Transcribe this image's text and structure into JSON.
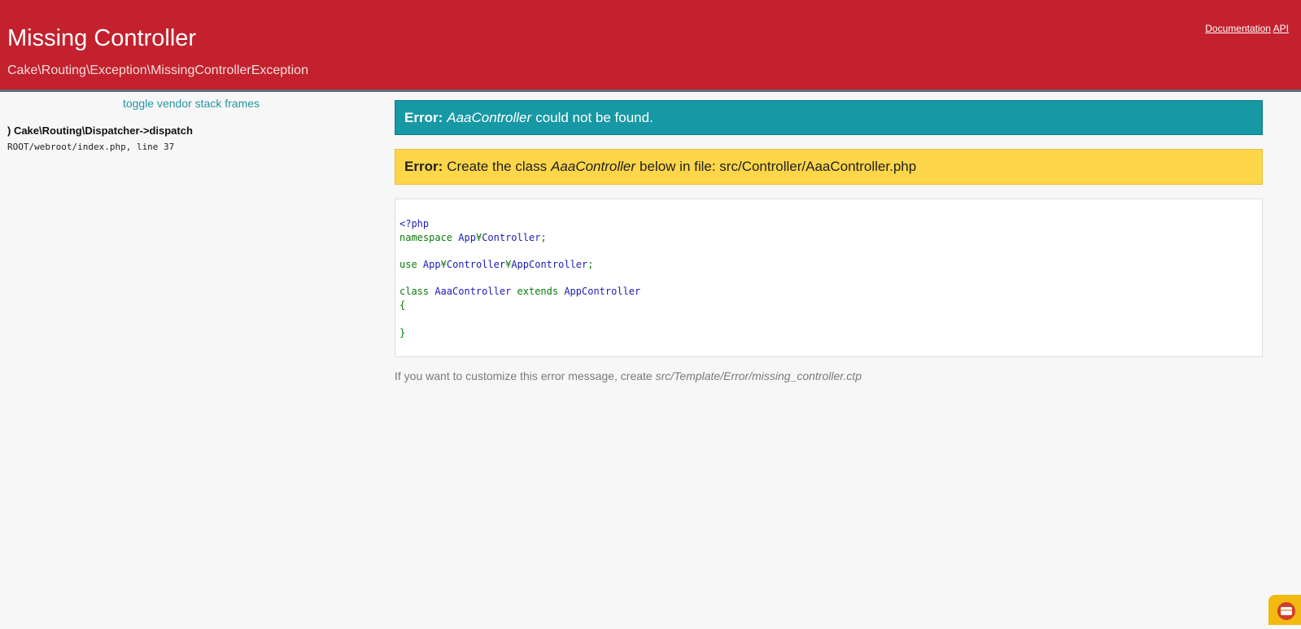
{
  "header": {
    "title": "Missing Controller",
    "exception": "Cake\\Routing\\Exception\\MissingControllerException",
    "links": {
      "documentation": "Documentation",
      "api": "API"
    }
  },
  "stack": {
    "toggle_label": "toggle vendor stack frames",
    "frames": [
      {
        "title": ") Cake\\Routing\\Dispatcher->dispatch",
        "file": "ROOT/webroot/index.php, line 37"
      }
    ]
  },
  "error1": {
    "label": "Error:",
    "class_name": "AaaController",
    "message": "could not be found."
  },
  "error2": {
    "label": "Error:",
    "prefix": "Create the class",
    "class_name": "AaaController",
    "suffix": "below in file: src/Controller/AaaController.php"
  },
  "code": {
    "php_open": "<?php",
    "namespace_kw": "namespace",
    "namespace_app": "App",
    "namespace_sep": "¥",
    "namespace_ctrl": "Controller",
    "use_kw": "use",
    "use_app": "App",
    "use_ctrl": "Controller",
    "use_appctrl": "AppController",
    "class_kw": "class",
    "class_name": "AaaController",
    "extends_kw": "extends",
    "parent": "AppController",
    "open_brace": "{",
    "close_brace": "}",
    "semicolon": ";"
  },
  "footer_note": {
    "text": "If you want to customize this error message, create",
    "path": "src/Template/Error/missing_controller.ctp"
  },
  "colors": {
    "header": "#c3212e",
    "teal": "#1798a5",
    "yellow": "#fed64a"
  },
  "icons": {
    "corner": "cakephp-debugkit-icon"
  }
}
